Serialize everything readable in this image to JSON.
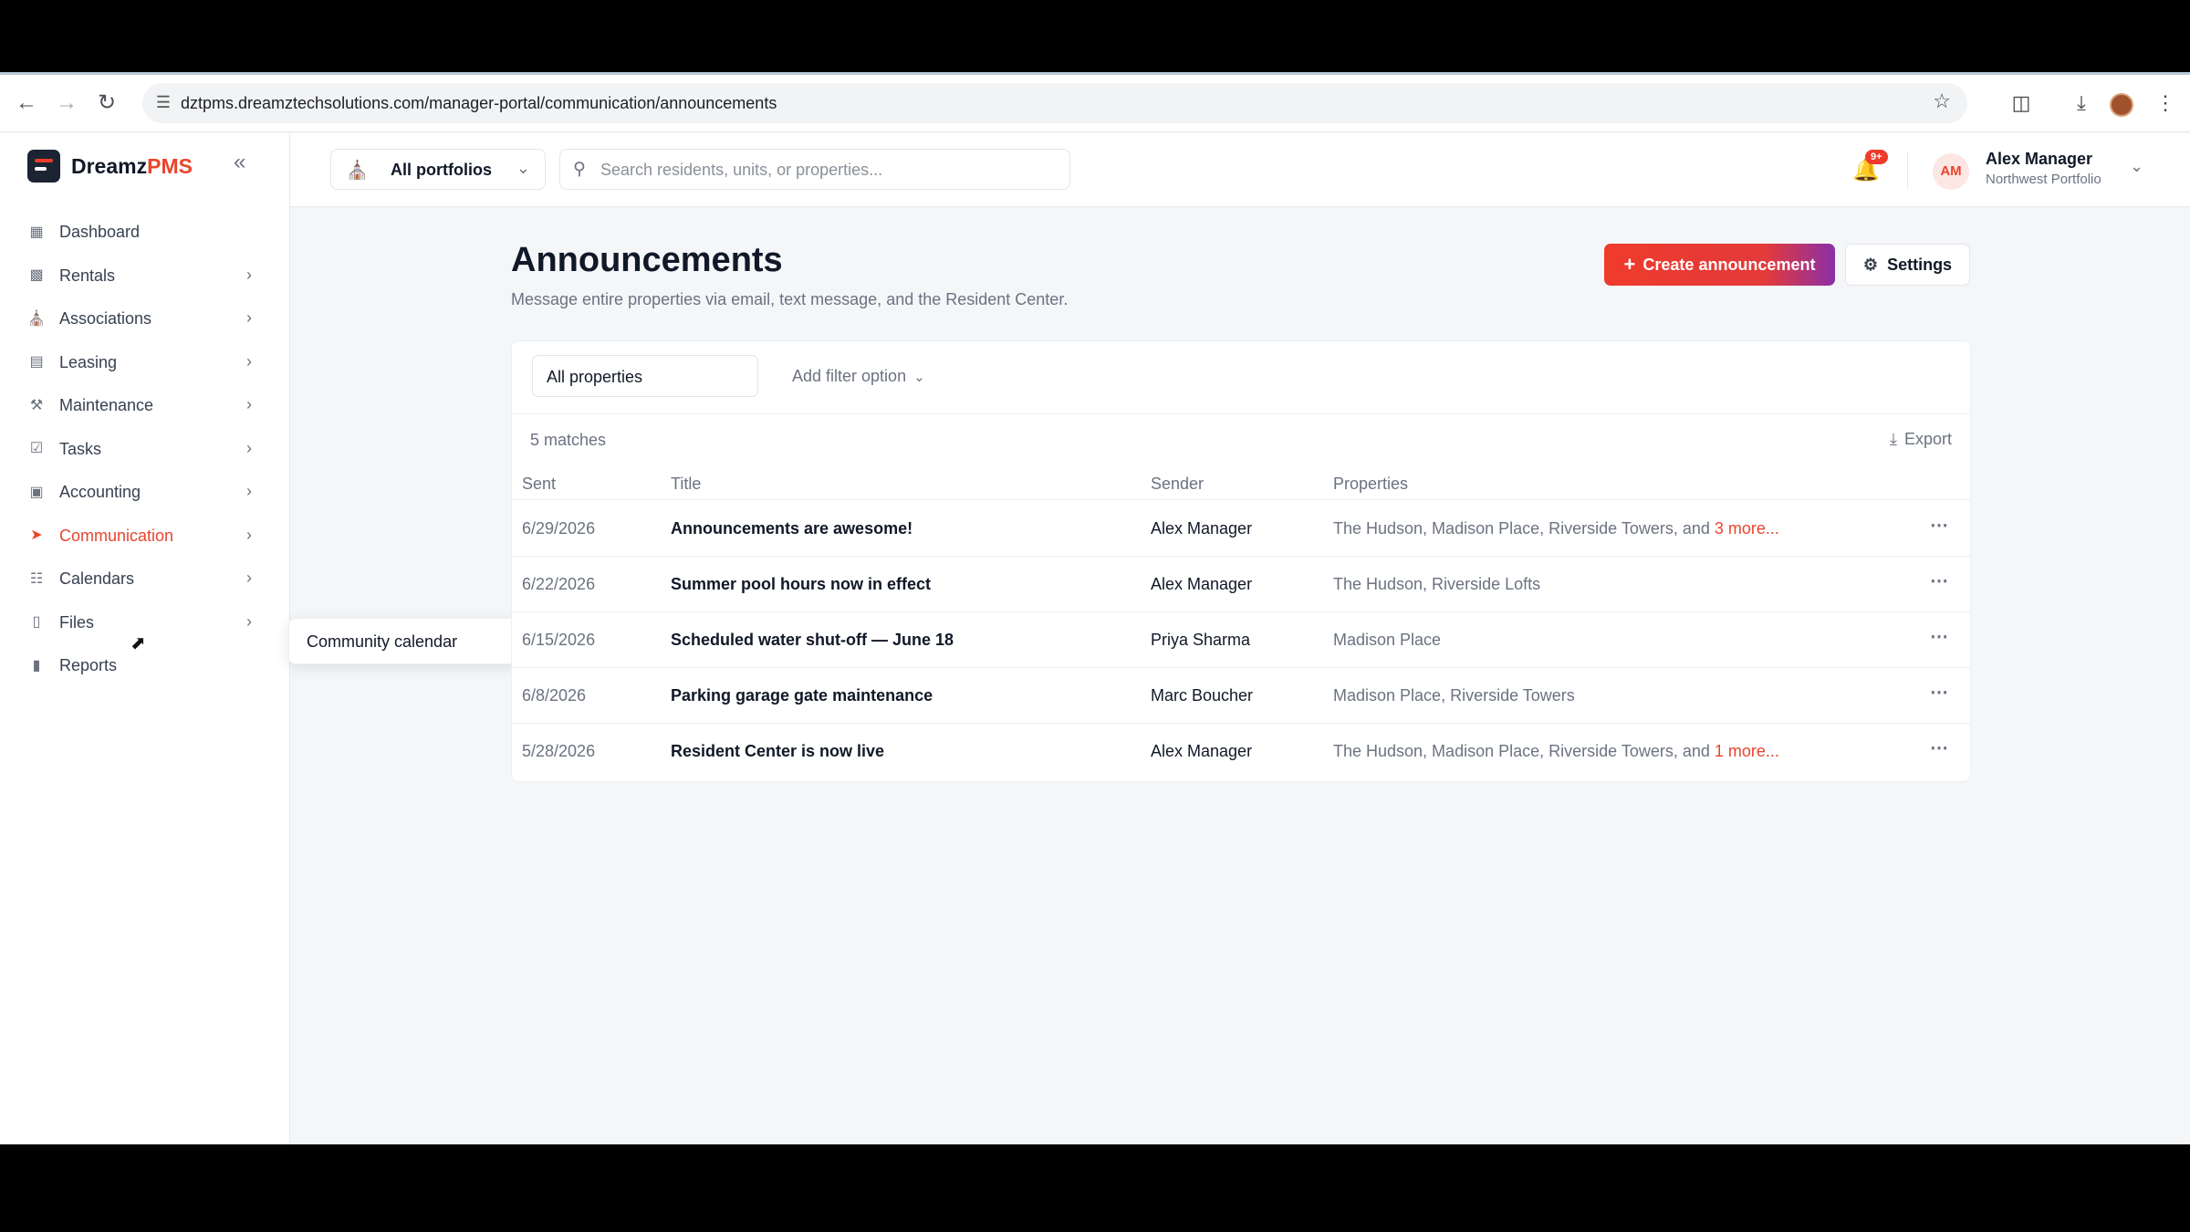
{
  "browser": {
    "url": "dztpms.dreamztechsolutions.com/manager-portal/communication/announcements"
  },
  "brand": {
    "name_main": "Dreamz",
    "name_accent": "PMS",
    "accent_color": "#e8452d"
  },
  "sidebar": {
    "items": [
      {
        "label": "Dashboard",
        "icon": "grid-icon",
        "has_chevron": false
      },
      {
        "label": "Rentals",
        "icon": "building-icon",
        "has_chevron": true
      },
      {
        "label": "Associations",
        "icon": "bank-icon",
        "has_chevron": true
      },
      {
        "label": "Leasing",
        "icon": "document-icon",
        "has_chevron": true
      },
      {
        "label": "Maintenance",
        "icon": "wrench-icon",
        "has_chevron": true
      },
      {
        "label": "Tasks",
        "icon": "checkbox-icon",
        "has_chevron": true
      },
      {
        "label": "Accounting",
        "icon": "wallet-icon",
        "has_chevron": true
      },
      {
        "label": "Communication",
        "icon": "send-icon",
        "has_chevron": true,
        "active": true
      },
      {
        "label": "Calendars",
        "icon": "calendar-icon",
        "has_chevron": true
      },
      {
        "label": "Files",
        "icon": "folder-icon",
        "has_chevron": true
      },
      {
        "label": "Reports",
        "icon": "bar-chart-icon",
        "has_chevron": false
      }
    ],
    "submenu": {
      "label": "Community calendar"
    }
  },
  "topbar": {
    "portfolio_label": "All portfolios",
    "search_placeholder": "Search residents, units, or properties...",
    "notifications_badge": "9+",
    "user": {
      "initials": "AM",
      "name": "Alex Manager",
      "portfolio": "Northwest Portfolio"
    }
  },
  "page": {
    "title": "Announcements",
    "subtitle": "Message entire properties via email, text message, and the Resident Center.",
    "create_label": "Create announcement",
    "settings_label": "Settings"
  },
  "filters": {
    "property_select": "All properties",
    "add_filter_label": "Add filter option"
  },
  "results": {
    "count_label": "5 matches",
    "export_label": "Export",
    "columns": {
      "sent": "Sent",
      "title": "Title",
      "sender": "Sender",
      "properties": "Properties"
    },
    "rows": [
      {
        "sent": "6/29/2026",
        "title": "Announcements are awesome!",
        "sender": "Alex Manager",
        "properties": "The Hudson, Madison Place, Riverside Towers, and ",
        "more": "3 more..."
      },
      {
        "sent": "6/22/2026",
        "title": "Summer pool hours now in effect",
        "sender": "Alex Manager",
        "properties": "The Hudson, Riverside Lofts",
        "more": ""
      },
      {
        "sent": "6/15/2026",
        "title": "Scheduled water shut-off — June 18",
        "sender": "Priya Sharma",
        "properties": "Madison Place",
        "more": ""
      },
      {
        "sent": "6/8/2026",
        "title": "Parking garage gate maintenance",
        "sender": "Marc Boucher",
        "properties": "Madison Place, Riverside Towers",
        "more": ""
      },
      {
        "sent": "5/28/2026",
        "title": "Resident Center is now live",
        "sender": "Alex Manager",
        "properties": "The Hudson, Madison Place, Riverside Towers, and ",
        "more": "1 more..."
      }
    ]
  }
}
